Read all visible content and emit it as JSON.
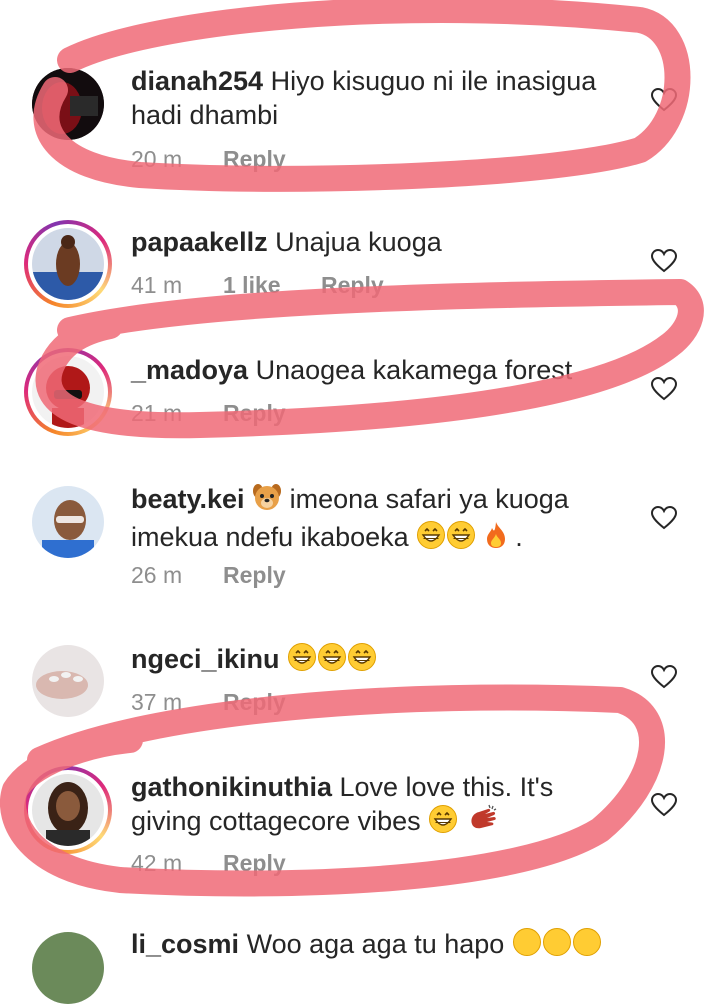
{
  "comments": [
    {
      "username": "dianah254",
      "text_line1": "Hiyo kisuguo ni ile inasigua",
      "text_line2": "hadi dhambi",
      "time": "20 m",
      "reply": "Reply"
    },
    {
      "username": "papaakellz",
      "text_line1": "Unajua kuoga",
      "time": "41 m",
      "likes": "1 like",
      "reply": "Reply"
    },
    {
      "username": "_madoya",
      "text_line1": "Unaogea kakamega forest",
      "time": "21 m",
      "reply": "Reply"
    },
    {
      "username": "beaty.kei",
      "text_line1": "imeona safari ya kuoga",
      "text_line2": "imekua ndefu ikaboeka",
      "text_line2_end": ".",
      "time": "26 m",
      "reply": "Reply"
    },
    {
      "username": "ngeci_ikinu",
      "time": "37 m",
      "reply": "Reply"
    },
    {
      "username": "gathonikinuthia",
      "text_line1": "Love love this. It's",
      "text_line2": "giving cottagecore vibes",
      "time": "42 m",
      "reply": "Reply"
    },
    {
      "username": "li_cosmi",
      "text_line1": "Woo aga aga tu hapo"
    }
  ],
  "colors": {
    "annotation": "#f06a77",
    "secondary_text": "#8e8e8e",
    "primary_text": "#262626"
  },
  "icons": [
    "heart-outline-icon",
    "dog-face-emoji",
    "grinning-emoji",
    "fire-emoji",
    "clapping-hands-emoji"
  ]
}
